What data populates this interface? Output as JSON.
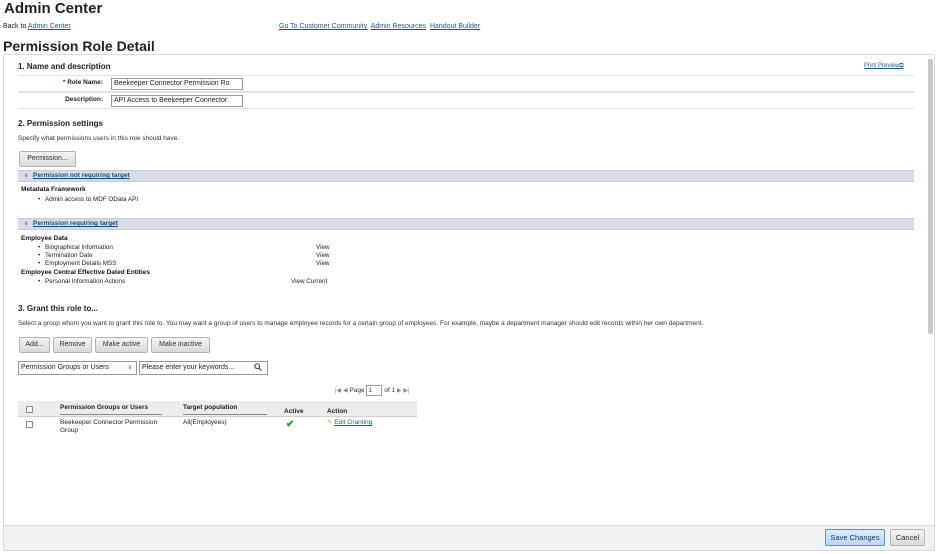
{
  "app_title": "Admin Center",
  "topbar": {
    "back_prefix": "Back to ",
    "back_link": "Admin Center",
    "links": [
      "Go To Customer Community",
      "Admin Resources",
      "Handout Builder"
    ]
  },
  "page_title": "Permission Role Detail",
  "print_preview": "Print Preview",
  "section1": {
    "heading": "1. Name and description",
    "role_name_label": "Role Name:",
    "role_name_value": "Beekeeper Connector Permission Ro",
    "description_label": "Description:",
    "description_value": "API Access to Beekeeper Connector"
  },
  "section2": {
    "heading": "2. Permission settings",
    "help": "Specify what permissions users in this role should have.",
    "permission_button": "Permission...",
    "group1": {
      "title": "Permission not requiring target",
      "categories": [
        {
          "name": "Metadata Framework",
          "items": [
            "Admin access to MDF OData API"
          ]
        }
      ]
    },
    "group2": {
      "title": "Permission requiring target",
      "categories": [
        {
          "name": "Employee Data",
          "items": [
            {
              "label": "Biographical Information",
              "value": "View"
            },
            {
              "label": "Termination Date",
              "value": "View"
            },
            {
              "label": "Employment Details MSS",
              "value": "View"
            }
          ]
        },
        {
          "name": "Employee Central Effective Dated Entities",
          "items": [
            {
              "label": "Personal Information Actions",
              "value": "View Current"
            }
          ]
        }
      ]
    }
  },
  "section3": {
    "heading": "3. Grant this role to...",
    "help": "Select a group whom you want to grant this role to. You may want a group of users to manage employee records for a certain group of employees. For example, maybe a department manager should edit records within her own department.",
    "buttons": {
      "add": "Add...",
      "remove": "Remove",
      "make_active": "Make active",
      "make_inactive": "Make inactive"
    },
    "filter_select": "Permission Groups or Users",
    "search_placeholder": "Please enter your keywords...",
    "pager": {
      "page_label": "Page",
      "page_value": "1",
      "of_label": "of 1"
    },
    "table": {
      "headers": [
        "Permission Groups or Users",
        "Target population",
        "Active",
        "Action"
      ],
      "rows": [
        {
          "group_line1": "Beekeeper Connector Permission",
          "group_line2": "Group",
          "target": "All(Employees)",
          "active": true,
          "action": "Edit Granting"
        }
      ]
    }
  },
  "footer": {
    "save": "Save Changes",
    "cancel": "Cancel"
  },
  "colors": {
    "section_bar": "#d6dde6",
    "link": "#1a5a9a",
    "active_check": "#2e9a2e",
    "save_button": "#b9d6f6"
  }
}
